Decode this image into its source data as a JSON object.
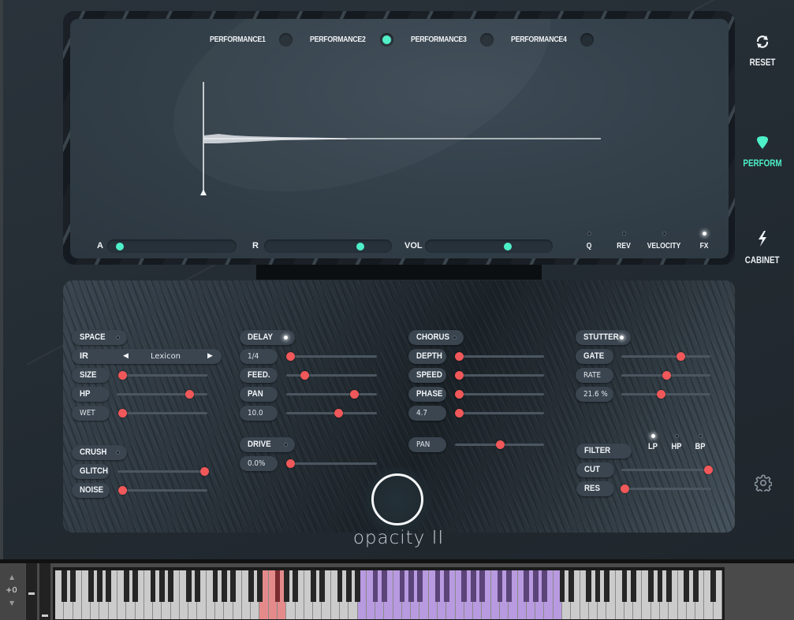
{
  "header": {
    "performances": [
      {
        "label": "PERFORMANCE1",
        "active": false
      },
      {
        "label": "PERFORMANCE2",
        "active": true
      },
      {
        "label": "PERFORMANCE3",
        "active": false
      },
      {
        "label": "PERFORMANCE4",
        "active": false
      }
    ]
  },
  "display": {
    "envelope": [
      {
        "label": "A",
        "value": 0.02
      },
      {
        "label": "R",
        "value": 0.8
      },
      {
        "label": "VOL",
        "value": 0.68
      }
    ],
    "toggles": [
      {
        "label": "Q",
        "on": false
      },
      {
        "label": "REV",
        "on": false
      },
      {
        "label": "VELOCITY",
        "on": false
      },
      {
        "label": "FX",
        "on": true
      }
    ]
  },
  "nav": {
    "reset_label": "RESET",
    "perform_label": "PERFORM",
    "cabinet_label": "CABINET",
    "active": "PERFORM",
    "settings_icon": "gear-icon"
  },
  "fx": {
    "space": {
      "label": "SPACE",
      "on": false,
      "ir": {
        "label": "IR",
        "value": "Lexicon",
        "prev_icon": "◀",
        "next_icon": "▶"
      },
      "params": [
        {
          "label": "SIZE",
          "value": 0.02
        },
        {
          "label": "HP",
          "value": 0.8
        },
        {
          "label": "WET",
          "value": 0.02
        }
      ]
    },
    "delay": {
      "label": "DELAY",
      "on": true,
      "params": [
        {
          "label": "1/4",
          "value": 0.02
        },
        {
          "label": "FEED.",
          "value": 0.2
        },
        {
          "label": "PAN",
          "value": 0.75
        },
        {
          "label": "10.0",
          "value": 0.57
        }
      ]
    },
    "chorus": {
      "label": "CHORUS",
      "on": false,
      "params": [
        {
          "label": "DEPTH",
          "value": 0.02
        },
        {
          "label": "SPEED",
          "value": 0.02
        },
        {
          "label": "PHASE",
          "value": 0.02
        },
        {
          "label": "4.7",
          "value": 0.02
        }
      ],
      "pan": {
        "label": "PAN",
        "value": 0.5
      }
    },
    "stutter": {
      "label": "STUTTER",
      "on": true,
      "params": [
        {
          "label": "GATE",
          "value": 0.66
        },
        {
          "label": "RATE",
          "value": 0.5
        },
        {
          "label": "21.6 %",
          "value": 0.44
        }
      ]
    },
    "crush": {
      "label": "CRUSH",
      "on": false,
      "params": [
        {
          "label": "GLITCH",
          "value": 0.98
        },
        {
          "label": "NOISE",
          "value": 0.02
        }
      ]
    },
    "drive": {
      "label": "DRIVE",
      "on": false,
      "params": [
        {
          "label": "0.0%",
          "value": 0.02
        }
      ]
    },
    "filter": {
      "label": "FILTER",
      "modes": [
        {
          "label": "LP",
          "on": true
        },
        {
          "label": "HP",
          "on": false
        },
        {
          "label": "BP",
          "on": false
        }
      ],
      "params": [
        {
          "label": "CUT",
          "value": 0.98
        },
        {
          "label": "RES",
          "value": 0.02
        }
      ]
    }
  },
  "logo": {
    "text": "opacity II"
  },
  "keyboard": {
    "octave_label": "+0",
    "octave_up_icon": "▲",
    "octave_down_icon": "▼",
    "white_key_count": 75,
    "keyswitch_range": [
      23,
      25
    ],
    "playable_range": [
      34,
      56
    ],
    "keyswitch_color": "#e58a8a",
    "playable_color": "#b89ae0"
  },
  "colors": {
    "accent_teal": "#4df0c8",
    "slider_knob_red": "#f0585a"
  }
}
